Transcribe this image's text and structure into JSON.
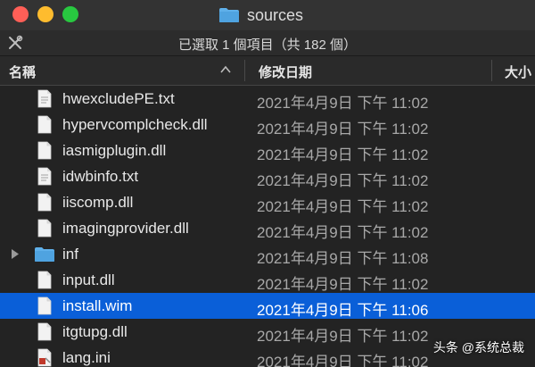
{
  "window": {
    "title": "sources",
    "status": "已選取 1 個項目（共 182 個）"
  },
  "columns": {
    "name": "名稱",
    "date": "修改日期",
    "size": "大小"
  },
  "files": [
    {
      "name": "hwexcludePE.txt",
      "date": "2021年4月9日 下午 11:02",
      "kind": "text",
      "selected": false
    },
    {
      "name": "hypervcomplcheck.dll",
      "date": "2021年4月9日 下午 11:02",
      "kind": "file",
      "selected": false
    },
    {
      "name": "iasmigplugin.dll",
      "date": "2021年4月9日 下午 11:02",
      "kind": "file",
      "selected": false
    },
    {
      "name": "idwbinfo.txt",
      "date": "2021年4月9日 下午 11:02",
      "kind": "text",
      "selected": false
    },
    {
      "name": "iiscomp.dll",
      "date": "2021年4月9日 下午 11:02",
      "kind": "file",
      "selected": false
    },
    {
      "name": "imagingprovider.dll",
      "date": "2021年4月9日 下午 11:02",
      "kind": "file",
      "selected": false
    },
    {
      "name": "inf",
      "date": "2021年4月9日 下午 11:08",
      "kind": "folder",
      "selected": false
    },
    {
      "name": "input.dll",
      "date": "2021年4月9日 下午 11:02",
      "kind": "file",
      "selected": false
    },
    {
      "name": "install.wim",
      "date": "2021年4月9日 下午 11:06",
      "kind": "file",
      "selected": true
    },
    {
      "name": "itgtupg.dll",
      "date": "2021年4月9日 下午 11:02",
      "kind": "file",
      "selected": false
    },
    {
      "name": "lang.ini",
      "date": "2021年4月9日 下午 11:02",
      "kind": "ini",
      "selected": false
    }
  ],
  "watermark": "头条 @系统总裁",
  "colors": {
    "selection": "#0a5fd8",
    "folder": "#4fa3e0"
  }
}
